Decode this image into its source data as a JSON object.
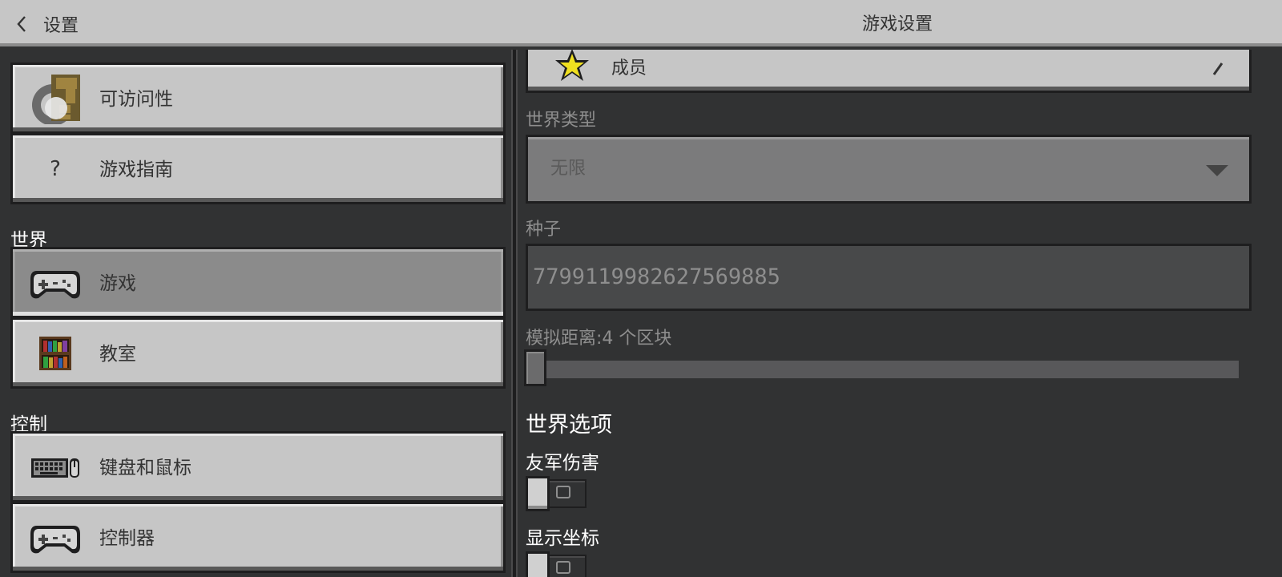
{
  "topbar": {
    "back_label": "设置",
    "title": "游戏设置"
  },
  "sidebar": {
    "items_top": [
      {
        "label": "可访问性",
        "icon": "accessibility-icon"
      },
      {
        "label": "游戏指南",
        "icon": "question-icon",
        "glyph": "?"
      }
    ],
    "sections": [
      {
        "label": "世界",
        "items": [
          {
            "label": "游戏",
            "icon": "gamepad-icon",
            "selected": true
          },
          {
            "label": "教室",
            "icon": "bookshelf-icon"
          }
        ]
      },
      {
        "label": "控制",
        "items": [
          {
            "label": "键盘和鼠标",
            "icon": "keyboard-mouse-icon"
          },
          {
            "label": "控制器",
            "icon": "controller-icon"
          }
        ]
      }
    ]
  },
  "main": {
    "member_label": "成员",
    "world_type": {
      "label": "世界类型",
      "value": "无限"
    },
    "seed": {
      "label": "种子",
      "value": "7799119982627569885"
    },
    "simulation_distance": {
      "label": "模拟距离:4 个区块",
      "value": 4
    },
    "world_options_title": "世界选项",
    "toggles": [
      {
        "label": "友军伤害",
        "on": false
      },
      {
        "label": "显示坐标",
        "on": false
      }
    ]
  },
  "colors": {
    "panel_bg": "#313233",
    "button_bg": "#c6c6c6",
    "selected_bg": "#8b8b8b",
    "border": "#1e1e1f"
  }
}
